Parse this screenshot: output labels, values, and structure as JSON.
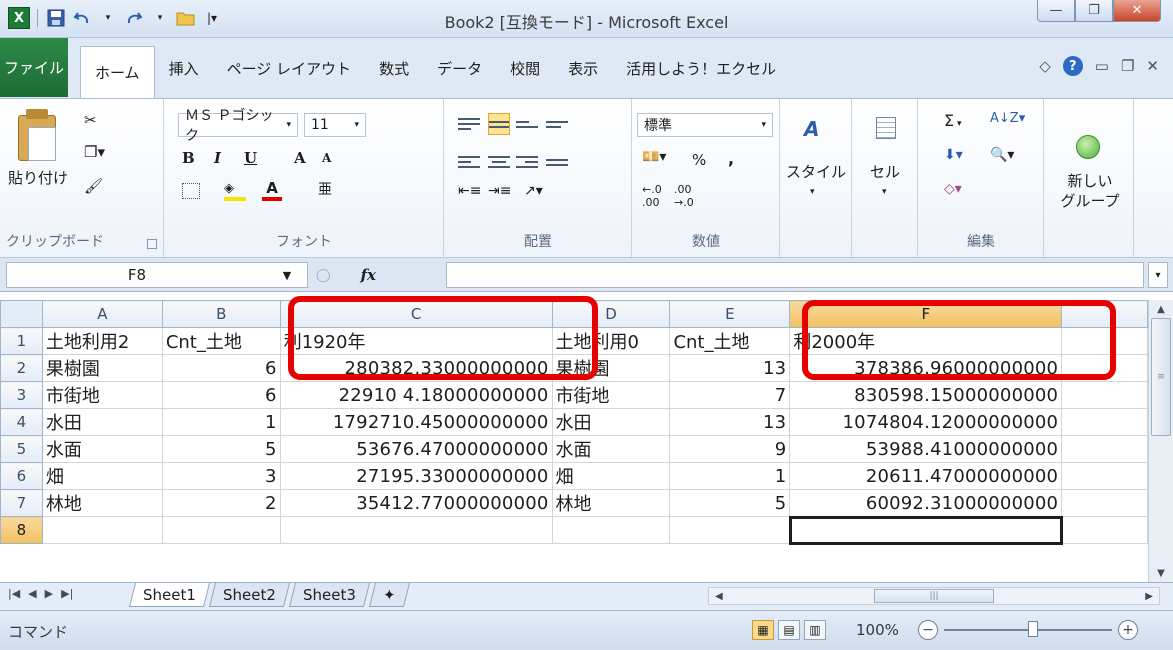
{
  "window": {
    "title": "Book2  [互換モード]  -  Microsoft Excel",
    "controls": {
      "minimize": "—",
      "restore": "❐",
      "close": "✕"
    },
    "qat": {
      "app_icon": "X",
      "save_icon": "floppy-icon",
      "undo_icon": "undo-icon",
      "redo_icon": "redo-icon",
      "open_icon": "folder-icon",
      "customize_icon": "|▾"
    }
  },
  "tabs": {
    "file": "ファイル",
    "items": [
      "ホーム",
      "挿入",
      "ページ レイアウト",
      "数式",
      "データ",
      "校閲",
      "表示",
      "活用しよう！エクセル"
    ],
    "active_index": 0
  },
  "ribbon": {
    "clipboard": {
      "paste": "貼り付け",
      "label": "クリップボード"
    },
    "font": {
      "name": "ＭＳ Ｐゴシック",
      "size": "11",
      "bold": "B",
      "italic": "I",
      "underline": "U",
      "grow": "A",
      "shrink": "A",
      "label": "フォント"
    },
    "alignment": {
      "label": "配置"
    },
    "number": {
      "format": "標準",
      "percent": "%",
      "comma": ",",
      "label": "数値"
    },
    "styles": {
      "label": "スタイル"
    },
    "cells": {
      "label": "セル"
    },
    "editing": {
      "label": "編集",
      "sum": "Σ"
    },
    "new_group": {
      "label": "新しい\nグループ"
    }
  },
  "formula_bar": {
    "name_box": "F8",
    "fx": "fx",
    "formula": ""
  },
  "sheet": {
    "columns": [
      "A",
      "B",
      "C",
      "D",
      "E",
      "F"
    ],
    "selected_column": "F",
    "selected_row": "8",
    "rows": [
      {
        "num": "1",
        "cells": [
          "土地利用2",
          "Cnt_土地",
          "利1920年",
          "土地利用0",
          "Cnt_土地",
          "利2000年"
        ]
      },
      {
        "num": "2",
        "cells": [
          "果樹園",
          "6",
          "280382.33000000000",
          "果樹園",
          "13",
          "378386.96000000000"
        ]
      },
      {
        "num": "3",
        "cells": [
          "市街地",
          "6",
          "22910 4.18000000000",
          "市街地",
          "7",
          "830598.15000000000"
        ]
      },
      {
        "num": "4",
        "cells": [
          "水田",
          "1",
          "1792710.45000000000",
          "水田",
          "13",
          "1074804.12000000000"
        ]
      },
      {
        "num": "5",
        "cells": [
          "水面",
          "5",
          "53676.47000000000",
          "水面",
          "9",
          "53988.41000000000"
        ]
      },
      {
        "num": "6",
        "cells": [
          "畑",
          "3",
          "27195.33000000000",
          "畑",
          "1",
          "20611.47000000000"
        ]
      },
      {
        "num": "7",
        "cells": [
          "林地",
          "2",
          "35412.77000000000",
          "林地",
          "5",
          "60092.31000000000"
        ]
      },
      {
        "num": "8",
        "cells": [
          "",
          "",
          "",
          "",
          "",
          ""
        ]
      }
    ]
  },
  "sheet_tabs": [
    "Sheet1",
    "Sheet2",
    "Sheet3"
  ],
  "status": {
    "mode": "コマンド",
    "zoom": "100%"
  },
  "highlight_color": "#e60000"
}
